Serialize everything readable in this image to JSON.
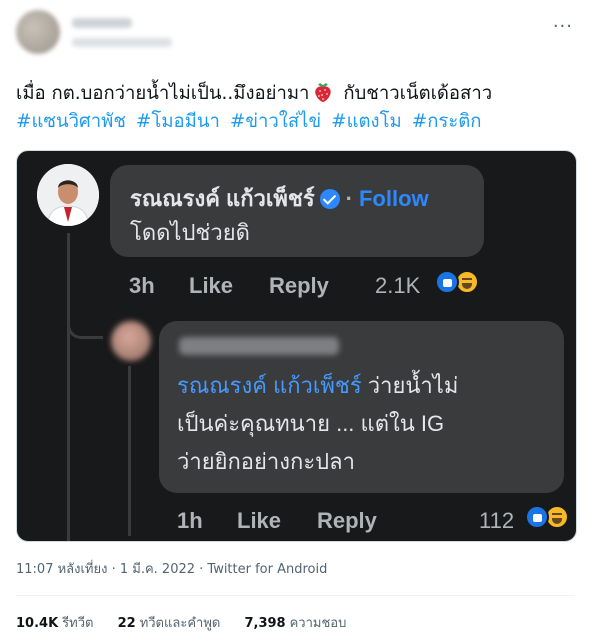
{
  "tweet": {
    "more_icon": "more-horizontal-icon",
    "text_line1_a": "เมื่อ กต.บอกว่ายน้ำไม่เป็น..มึงอย่ามา",
    "text_line1_b": "กับชาวเน็ตเด้อสาว",
    "hashtags": [
      "#แซนวิศาพัช",
      "#โมอมีนา",
      "#ข่าวใส่ไข่",
      "#แตงโม",
      "#กระติก"
    ],
    "emoji_icon": "strawberry-icon"
  },
  "screenshot": {
    "comment1": {
      "name": "รณณรงค์ แก้วเพ็ชร์",
      "separator": "·",
      "follow": "Follow",
      "text": "โดดไปช่วยดิ",
      "time": "3h",
      "like": "Like",
      "reply": "Reply",
      "reaction_count": "2.1K"
    },
    "comment2": {
      "mention": "รณณรงค์ แก้วเพ็ชร์",
      "text_a": " ว่ายน้ำไม่",
      "text_b": "เป็นค่ะคุณทนาย ... แต่ใน IG",
      "text_c": "ว่ายยิกอย่างกะปลา",
      "time": "1h",
      "like": "Like",
      "reply": "Reply",
      "reaction_count": "112"
    },
    "colors": {
      "background": "#18191a",
      "bubble": "#3a3b3c",
      "link": "#2d88ff"
    }
  },
  "meta": {
    "text": "11:07 หลังเที่ยง · 1 มี.ค. 2022 · Twitter for Android"
  },
  "stats": {
    "retweets": {
      "value": "10.4K",
      "label": "รีทวีต"
    },
    "quotes": {
      "value": "22",
      "label": "ทวีตและคำพูด"
    },
    "likes": {
      "value": "7,398",
      "label": "ความชอบ"
    }
  }
}
